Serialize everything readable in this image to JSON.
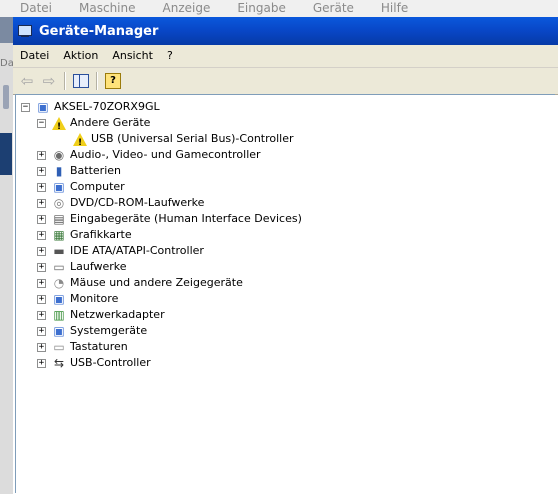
{
  "host_menu": [
    "Datei",
    "Maschine",
    "Anzeige",
    "Eingabe",
    "Geräte",
    "Hilfe"
  ],
  "host_strip_text": "Da",
  "window": {
    "title": "Geräte-Manager"
  },
  "menubar": [
    "Datei",
    "Aktion",
    "Ansicht",
    "?"
  ],
  "toolbar": {
    "back_glyph": "⇦",
    "forward_glyph": "⇨",
    "prop_glyph": "?"
  },
  "tree": {
    "root": {
      "label": "AKSEL-70ZORX9GL",
      "expander": "−"
    },
    "andere": {
      "label": "Andere Geräte",
      "expander": "−",
      "child": "USB (Universal Serial Bus)-Controller"
    },
    "categories": [
      {
        "label": "Audio-, Video- und Gamecontroller",
        "icon": "speaker-icon",
        "glyph": "◉",
        "color": "#6b6b6b"
      },
      {
        "label": "Batterien",
        "icon": "battery-icon",
        "glyph": "▮",
        "color": "#2f5fb5"
      },
      {
        "label": "Computer",
        "icon": "computer-icon",
        "glyph": "▣",
        "color": "#3d6fcf"
      },
      {
        "label": "DVD/CD-ROM-Laufwerke",
        "icon": "cd-drive-icon",
        "glyph": "◎",
        "color": "#7a7a7a"
      },
      {
        "label": "Eingabegeräte (Human Interface Devices)",
        "icon": "hid-icon",
        "glyph": "▤",
        "color": "#555555"
      },
      {
        "label": "Grafikkarte",
        "icon": "display-adapter-icon",
        "glyph": "▦",
        "color": "#3a7a3a"
      },
      {
        "label": "IDE ATA/ATAPI-Controller",
        "icon": "ide-controller-icon",
        "glyph": "▬",
        "color": "#555555"
      },
      {
        "label": "Laufwerke",
        "icon": "disk-drive-icon",
        "glyph": "▭",
        "color": "#6b6b6b"
      },
      {
        "label": "Mäuse und andere Zeigegeräte",
        "icon": "mouse-icon",
        "glyph": "◔",
        "color": "#8a8a8a"
      },
      {
        "label": "Monitore",
        "icon": "monitor-icon",
        "glyph": "▣",
        "color": "#3d6fcf"
      },
      {
        "label": "Netzwerkadapter",
        "icon": "network-adapter-icon",
        "glyph": "▥",
        "color": "#2f8a2f"
      },
      {
        "label": "Systemgeräte",
        "icon": "system-devices-icon",
        "glyph": "▣",
        "color": "#3d6fcf"
      },
      {
        "label": "Tastaturen",
        "icon": "keyboard-icon",
        "glyph": "▭",
        "color": "#8a8a8a"
      },
      {
        "label": "USB-Controller",
        "icon": "usb-icon",
        "glyph": "⇆",
        "color": "#333333"
      }
    ],
    "collapsed_expander": "+"
  }
}
